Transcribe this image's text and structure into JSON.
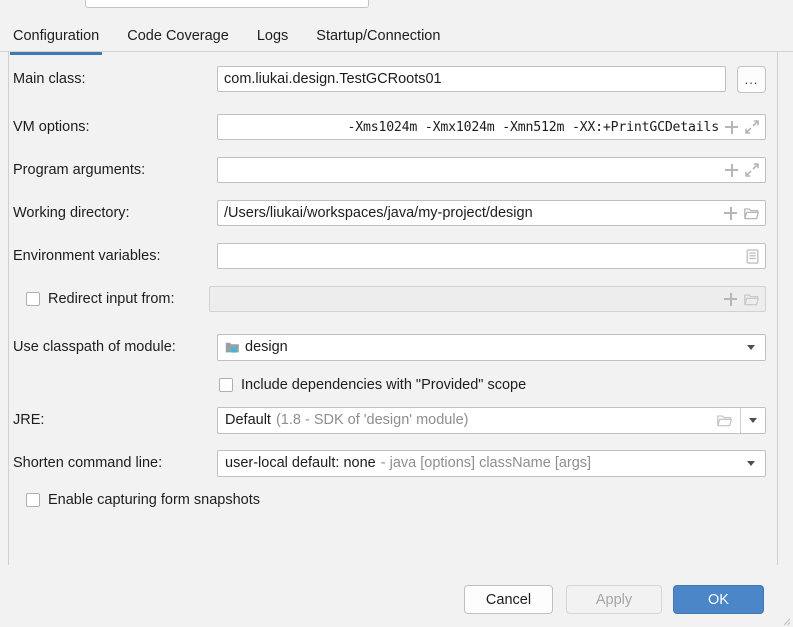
{
  "window": {
    "top_field_value": ""
  },
  "tabs": [
    {
      "label": "Configuration",
      "active": true
    },
    {
      "label": "Code Coverage",
      "active": false
    },
    {
      "label": "Logs",
      "active": false
    },
    {
      "label": "Startup/Connection",
      "active": false
    }
  ],
  "form": {
    "main_class": {
      "label": "Main class:",
      "value": "com.liukai.design.TestGCRoots01",
      "browse_label": "..."
    },
    "vm_options": {
      "label": "VM options:",
      "value": "-Xms1024m -Xmx1024m -Xmn512m -XX:+PrintGCDetails",
      "placeholder": ""
    },
    "program_arguments": {
      "label": "Program arguments:",
      "value": "",
      "placeholder": ""
    },
    "working_directory": {
      "label": "Working directory:",
      "value": "/Users/liukai/workspaces/java/my-project/design",
      "placeholder": ""
    },
    "environment_variables": {
      "label": "Environment variables:",
      "value": "",
      "placeholder": ""
    },
    "redirect_input": {
      "label": "Redirect input from:",
      "checked": false,
      "value": "",
      "placeholder": ""
    },
    "classpath_module": {
      "label": "Use classpath of module:",
      "value": "design"
    },
    "include_provided": {
      "label": "Include dependencies with \"Provided\" scope",
      "checked": false
    },
    "jre": {
      "label": "JRE:",
      "value": "Default",
      "hint": "(1.8 - SDK of 'design' module)"
    },
    "shorten_command_line": {
      "label": "Shorten command line:",
      "value": "user-local default: none",
      "hint": "- java [options] className [args]"
    },
    "form_snapshots": {
      "label": "Enable capturing form snapshots",
      "checked": false
    }
  },
  "footer": {
    "cancel": "Cancel",
    "apply": "Apply",
    "ok": "OK"
  },
  "colors": {
    "accent": "#4a86c8",
    "tab_underline": "#3d7ab3",
    "background": "#f2f2f2",
    "muted_text": "#8e8e8e"
  },
  "icons": {
    "plus": "plus-icon",
    "expand": "expand-icon",
    "folder": "folder-icon",
    "list": "list-icon",
    "module": "module-icon",
    "caret": "chevron-down-icon"
  }
}
